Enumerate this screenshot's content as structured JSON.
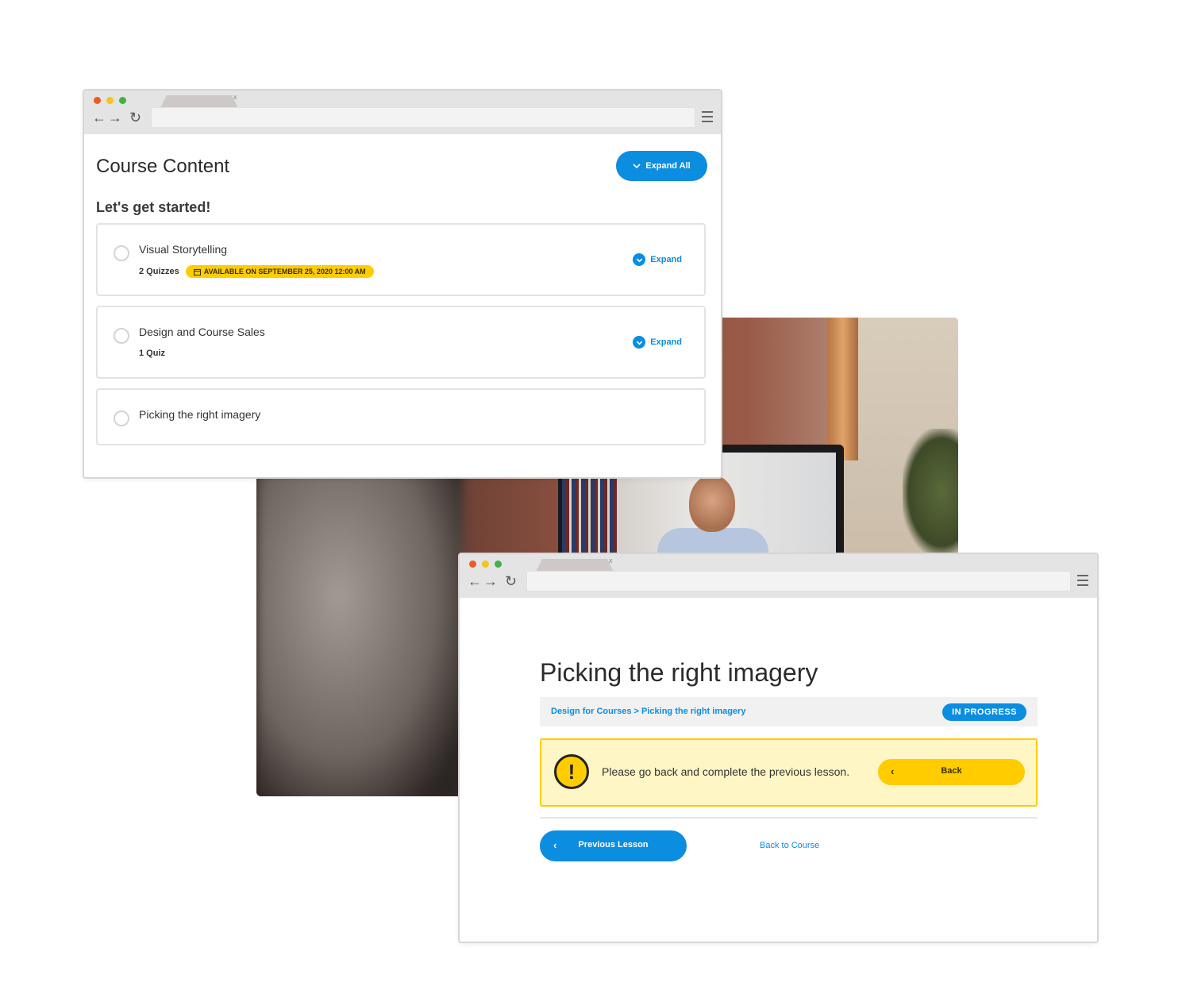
{
  "window1": {
    "tab_close": "x",
    "title": "Course Content",
    "expand_all_label": "Expand All",
    "section_heading": "Let's get started!",
    "lessons": [
      {
        "name": "Visual Storytelling",
        "meta": "2 Quizzes",
        "badge": "AVAILABLE ON SEPTEMBER 25, 2020 12:00 AM",
        "expand_label": "Expand"
      },
      {
        "name": "Design and Course Sales",
        "meta": "1 Quiz",
        "expand_label": "Expand"
      },
      {
        "name": "Picking the right imagery"
      }
    ]
  },
  "window2": {
    "tab_close": "x",
    "lesson_title": "Picking the right imagery",
    "breadcrumb": {
      "course": "Design for Courses",
      "separator": ">",
      "lesson": "Picking the right imagery"
    },
    "status": "IN PROGRESS",
    "alert": {
      "icon": "!",
      "message": "Please go back and complete the previous lesson.",
      "button_label": "Back"
    },
    "previous_lesson_label": "Previous Lesson",
    "back_to_course_label": "Back to Course"
  },
  "colors": {
    "accent_blue": "#0b8de0",
    "accent_yellow": "#ffcc00",
    "alert_bg": "#fff6c5"
  },
  "icons": [
    "chevron-down-icon",
    "calendar-icon",
    "chevron-left-icon",
    "warning-icon",
    "back-arrow-icon",
    "forward-arrow-icon",
    "reload-icon",
    "menu-icon"
  ]
}
